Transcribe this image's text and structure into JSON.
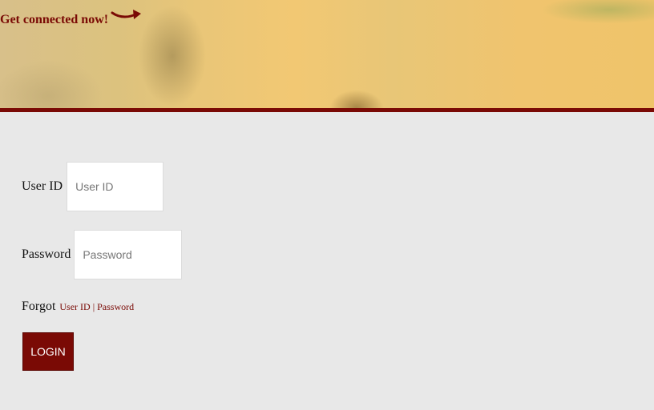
{
  "banner": {
    "tagline": "Get connected now!"
  },
  "form": {
    "user_id_label": "User ID",
    "user_id_placeholder": "User ID",
    "password_label": "Password",
    "password_placeholder": "Password",
    "forgot_label": "Forgot",
    "forgot_user_id_link": "User ID",
    "forgot_separator": "|",
    "forgot_password_link": "Password",
    "login_button": "LOGIN"
  },
  "colors": {
    "brand": "#7a0a05",
    "background": "#e8e8e8"
  },
  "icons": {
    "banner_arrow": "curved-arrow-icon"
  }
}
